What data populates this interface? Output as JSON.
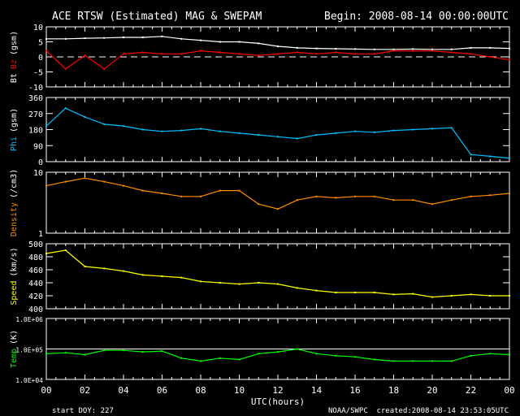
{
  "chart_data": {
    "type": "line",
    "title": "ACE RTSW (Estimated) MAG & SWEPAM",
    "begin": "Begin: 2008-08-14 00:00:00UTC",
    "xlabel": "UTC(hours)",
    "x_ticks": [
      "00",
      "02",
      "04",
      "06",
      "08",
      "10",
      "12",
      "14",
      "16",
      "18",
      "20",
      "22",
      "00"
    ],
    "xlim": [
      0,
      24
    ],
    "x": [
      0,
      1,
      2,
      3,
      4,
      5,
      6,
      7,
      8,
      9,
      10,
      11,
      12,
      13,
      14,
      15,
      16,
      17,
      18,
      19,
      20,
      21,
      22,
      23,
      24
    ],
    "footer_left": "start DOY: 227",
    "footer_mid": "NOAA/SWPC",
    "footer_right": "created:2008-08-14 23:53:05UTC",
    "panels": [
      {
        "name": "mag",
        "ylabel_parts": [
          {
            "text": "Bt",
            "color": "#ffffff"
          },
          {
            "text": "Bz",
            "color": "#ff0000"
          },
          {
            "text": "(gsm)",
            "color": "#ffffff"
          }
        ],
        "ylim": [
          -10,
          10
        ],
        "scale": "linear",
        "ticks": [
          "10",
          "5",
          "0",
          "-5",
          "-10"
        ],
        "tick_values": [
          10,
          5,
          0,
          -5,
          -10
        ],
        "zero_line": true,
        "series": [
          {
            "name": "Bt",
            "color": "#ffffff",
            "values": [
              6,
              6,
              6.2,
              6.3,
              6.5,
              6.5,
              6.8,
              6,
              5.5,
              5,
              5,
              4.5,
              3.5,
              3,
              2.8,
              2.7,
              2.6,
              2.5,
              2.5,
              2.6,
              2.5,
              2.5,
              3,
              3,
              2.8
            ]
          },
          {
            "name": "Bz",
            "color": "#ff0000",
            "values": [
              2,
              -4,
              0.5,
              -4,
              1,
              1.5,
              1,
              1,
              2,
              1.5,
              1,
              0.5,
              1,
              1.5,
              1,
              1.5,
              1,
              1,
              2,
              2,
              2,
              1.5,
              1,
              0,
              -1
            ]
          }
        ]
      },
      {
        "name": "phi",
        "ylabel_parts": [
          {
            "text": "Phi",
            "color": "#00bfff"
          },
          {
            "text": "(gsm)",
            "color": "#ffffff"
          }
        ],
        "ylim": [
          0,
          360
        ],
        "scale": "linear",
        "ticks": [
          "360",
          "270",
          "180",
          "90",
          "0"
        ],
        "tick_values": [
          360,
          270,
          180,
          90,
          0
        ],
        "series": [
          {
            "name": "Phi",
            "color": "#00bfff",
            "values": [
              200,
              300,
              250,
              210,
              200,
              180,
              170,
              175,
              185,
              170,
              160,
              150,
              140,
              130,
              150,
              160,
              170,
              165,
              175,
              180,
              185,
              190,
              40,
              30,
              20
            ]
          }
        ]
      },
      {
        "name": "density",
        "ylabel_parts": [
          {
            "text": "Density",
            "color": "#ff8c00"
          },
          {
            "text": "(/cm3)",
            "color": "#ffffff"
          }
        ],
        "ylim": [
          1,
          10
        ],
        "scale": "log",
        "ticks": [
          "10",
          "1"
        ],
        "tick_values": [
          10,
          1
        ],
        "series": [
          {
            "name": "Density",
            "color": "#ff8c00",
            "values": [
              6,
              7,
              8,
              7,
              6,
              5,
              4.5,
              4,
              4,
              5,
              5,
              3,
              2.5,
              3.5,
              4,
              3.8,
              4,
              4,
              3.5,
              3.5,
              3,
              3.5,
              4,
              4.2,
              4.5
            ]
          }
        ]
      },
      {
        "name": "speed",
        "ylabel_parts": [
          {
            "text": "Speed",
            "color": "#ffff00"
          },
          {
            "text": "(km/s)",
            "color": "#ffffff"
          }
        ],
        "ylim": [
          400,
          500
        ],
        "scale": "linear",
        "ticks": [
          "500",
          "480",
          "460",
          "440",
          "420",
          "400"
        ],
        "tick_values": [
          500,
          480,
          460,
          440,
          420,
          400
        ],
        "series": [
          {
            "name": "Speed",
            "color": "#ffff00",
            "values": [
              485,
              490,
              465,
              462,
              458,
              452,
              450,
              448,
              442,
              440,
              438,
              440,
              438,
              432,
              428,
              425,
              425,
              425,
              422,
              423,
              418,
              420,
              422,
              420,
              420
            ]
          }
        ]
      },
      {
        "name": "temp",
        "ylabel_parts": [
          {
            "text": "Temp",
            "color": "#00ff00"
          },
          {
            "text": "(K)",
            "color": "#ffffff"
          }
        ],
        "ylim": [
          10000,
          1000000
        ],
        "scale": "log",
        "ticks": [
          "1.0E+06",
          "1.0E+05",
          "1.0E+04"
        ],
        "tick_values": [
          1000000,
          100000,
          10000
        ],
        "ref_line": 100000,
        "series": [
          {
            "name": "Temp",
            "color": "#00ff00",
            "values": [
              70000,
              75000,
              65000,
              90000,
              90000,
              80000,
              85000,
              50000,
              40000,
              50000,
              45000,
              70000,
              80000,
              100000,
              70000,
              60000,
              55000,
              45000,
              40000,
              40000,
              40000,
              40000,
              60000,
              70000,
              65000
            ]
          }
        ]
      }
    ]
  }
}
